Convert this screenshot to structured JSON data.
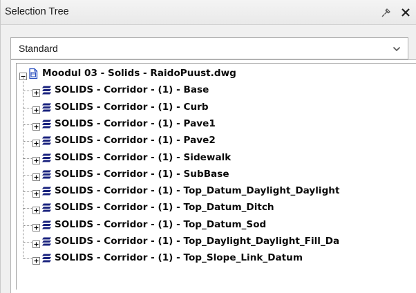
{
  "panel": {
    "title": "Selection Tree",
    "pin_icon": "pin-icon",
    "close_icon": "close-icon"
  },
  "selector": {
    "value": "Standard",
    "arrow_icon": "chevron-down-icon"
  },
  "tree": {
    "root": {
      "label": "Moodul 03 - Solids - RaidoPuust.dwg",
      "icon": "document-icon",
      "expanded": true
    },
    "children": [
      {
        "label": "SOLIDS - Corridor - (1) - Base",
        "icon": "layers-icon",
        "expanded": false
      },
      {
        "label": "SOLIDS - Corridor - (1) - Curb",
        "icon": "layers-icon",
        "expanded": false
      },
      {
        "label": "SOLIDS - Corridor - (1) - Pave1",
        "icon": "layers-icon",
        "expanded": false
      },
      {
        "label": "SOLIDS - Corridor - (1) - Pave2",
        "icon": "layers-icon",
        "expanded": false
      },
      {
        "label": "SOLIDS - Corridor - (1) - Sidewalk",
        "icon": "layers-icon",
        "expanded": false
      },
      {
        "label": "SOLIDS - Corridor - (1) - SubBase",
        "icon": "layers-icon",
        "expanded": false
      },
      {
        "label": "SOLIDS - Corridor - (1) - Top_Datum_Daylight_Daylight",
        "icon": "layers-icon",
        "expanded": false
      },
      {
        "label": "SOLIDS - Corridor - (1) - Top_Datum_Ditch",
        "icon": "layers-icon",
        "expanded": false
      },
      {
        "label": "SOLIDS - Corridor - (1) - Top_Datum_Sod",
        "icon": "layers-icon",
        "expanded": false
      },
      {
        "label": "SOLIDS - Corridor - (1) - Top_Daylight_Daylight_Fill_Da",
        "icon": "layers-icon",
        "expanded": false
      },
      {
        "label": "SOLIDS - Corridor - (1) - Top_Slope_Link_Datum",
        "icon": "layers-icon",
        "expanded": false
      }
    ]
  },
  "colors": {
    "panel_bg": "#f0f0f0",
    "tree_bg": "#ffffff",
    "document_icon": "#2a4fbf",
    "layers_icon": "#1a237e"
  }
}
